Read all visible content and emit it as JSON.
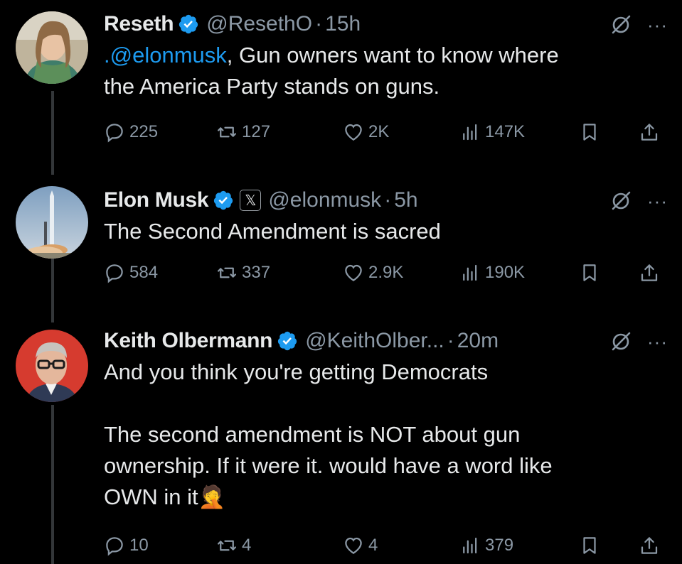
{
  "tweets": [
    {
      "name": "Reseth",
      "handle": "@ResethO",
      "time": "15h",
      "mention": ".@elonmusk",
      "text": ", Gun owners want to know where\nthe America Party stands on guns.",
      "stats": {
        "replies": "225",
        "reposts": "127",
        "likes": "2K",
        "views": "147K"
      }
    },
    {
      "name": "Elon Musk",
      "handle": "@elonmusk",
      "time": "5h",
      "x_badge": "𝕏",
      "text": "The Second Amendment is sacred",
      "stats": {
        "replies": "584",
        "reposts": "337",
        "likes": "2.9K",
        "views": "190K"
      }
    },
    {
      "name": "Keith Olbermann",
      "handle": "@KeithOlber...",
      "time": "20m",
      "text": "And you think you're getting Democrats\n\nThe second amendment is NOT about gun\nownership. If it were it. would have a word like\nOWN in it",
      "emoji": "🤦",
      "stats": {
        "replies": "10",
        "reposts": "4",
        "likes": "4",
        "views": "379"
      }
    }
  ],
  "ui": {
    "dot": "·",
    "more": "···"
  },
  "colors": {
    "background": "#000000",
    "text": "#e7e9ea",
    "muted": "#8b98a5",
    "link": "#1d9bf0",
    "verified": "#1d9bf0"
  }
}
